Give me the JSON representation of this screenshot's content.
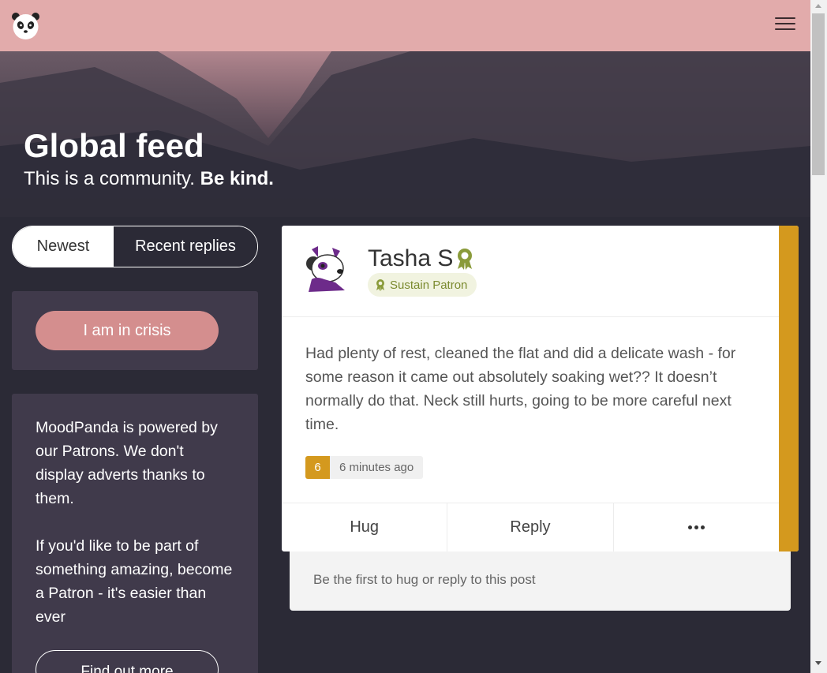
{
  "header": {
    "logo_icon": "panda-logo-icon",
    "menu_icon": "hamburger-menu-icon",
    "bg_color": "#e2abab"
  },
  "hero": {
    "title": "Global feed",
    "subtitle_prefix": "This is a community.",
    "subtitle_bold": "Be kind."
  },
  "tabs": {
    "newest": "Newest",
    "recent_replies": "Recent replies",
    "active": "Recent replies"
  },
  "crisis": {
    "button_label": "I am in crisis",
    "color": "#d48e8e"
  },
  "patron_promo": {
    "paragraph1": "MoodPanda is powered by our Patrons. We don't display adverts thanks to them.",
    "paragraph2": "If you'd like to be part of something amazing, become a Patron - it's easier than ever",
    "button_label": "Find out more"
  },
  "post": {
    "author": "Tasha S",
    "badge": "Sustain Patron",
    "award_icon": "award-ribbon-icon",
    "body": "Had plenty of rest, cleaned the flat and did a delicate wash - for some reason it came out absolutely soaking wet?? It doesn’t normally do that. Neck still hurts, going to be more careful next time.",
    "rating": "6",
    "time": "6 minutes ago",
    "accent_color": "#d4991e",
    "actions": {
      "hug": "Hug",
      "reply": "Reply",
      "more_icon": "more-dots-icon"
    },
    "empty_replies": "Be the first to hug or reply to this post"
  }
}
